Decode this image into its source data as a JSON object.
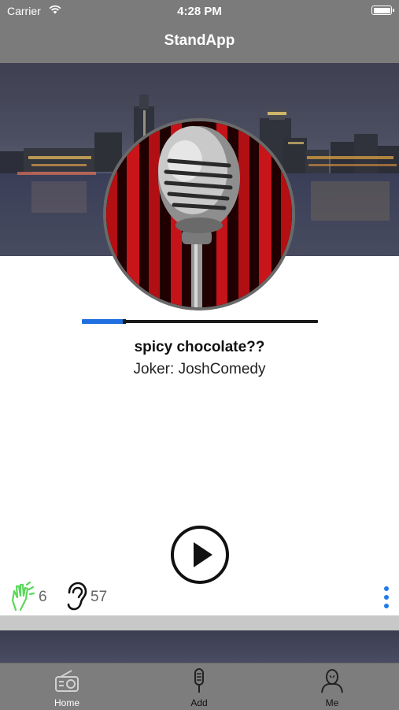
{
  "status_bar": {
    "carrier": "Carrier",
    "time": "4:28 PM",
    "wifi_icon": "wifi-icon",
    "battery_icon": "battery-icon"
  },
  "nav": {
    "title": "StandApp"
  },
  "player": {
    "cover_icon": "microphone-stage-image",
    "progress": 0.18,
    "joke_title": "spicy chocolate??",
    "joke_author": "Joker: JoshComedy",
    "play_icon": "play-icon"
  },
  "stats": {
    "claps_icon": "clapping-hands-icon",
    "claps": "6",
    "listens_icon": "ear-icon",
    "listens": "57",
    "more_icon": "more-vertical-icon"
  },
  "colors": {
    "bar_gray": "#7b7b7b",
    "accent_blue": "#1f6fe0",
    "clap_green": "#5ad85a"
  },
  "tabs": [
    {
      "label": "Home",
      "icon": "radio-icon",
      "active": true
    },
    {
      "label": "Add",
      "icon": "microphone-icon",
      "active": false
    },
    {
      "label": "Me",
      "icon": "user-icon",
      "active": false
    }
  ]
}
